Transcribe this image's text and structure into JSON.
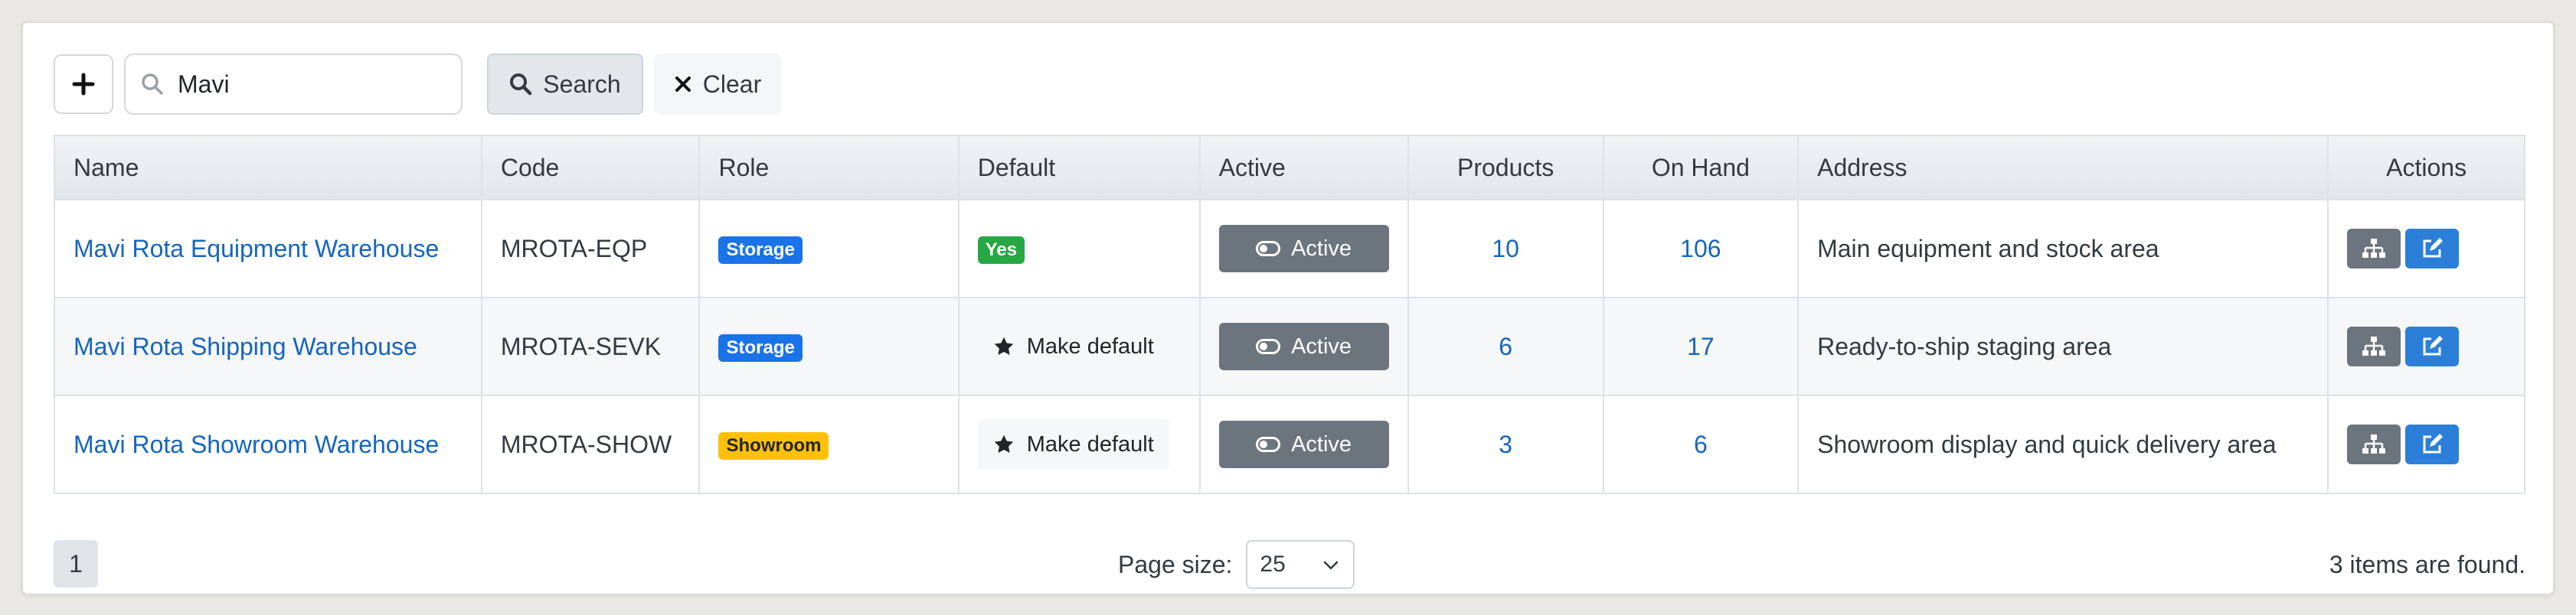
{
  "toolbar": {
    "add_label": "+",
    "search_value": "Mavi",
    "search_label": "Search",
    "clear_label": "Clear"
  },
  "table": {
    "columns": [
      "Name",
      "Code",
      "Role",
      "Default",
      "Active",
      "Products",
      "On Hand",
      "Address",
      "Actions"
    ],
    "rows": [
      {
        "name": "Mavi Rota Equipment Warehouse",
        "code": "MROTA-EQP",
        "role": "Storage",
        "default": "Yes",
        "default_is_set": true,
        "active": "Active",
        "products": "10",
        "on_hand": "106",
        "address": "Main equipment and stock area"
      },
      {
        "name": "Mavi Rota Shipping Warehouse",
        "code": "MROTA-SEVK",
        "role": "Storage",
        "default": "Make default",
        "default_is_set": false,
        "active": "Active",
        "products": "6",
        "on_hand": "17",
        "address": "Ready-to-ship staging area"
      },
      {
        "name": "Mavi Rota Showroom Warehouse",
        "code": "MROTA-SHOW",
        "role": "Showroom",
        "default": "Make default",
        "default_is_set": false,
        "active": "Active",
        "products": "3",
        "on_hand": "6",
        "address": "Showroom display and quick delivery area"
      }
    ]
  },
  "footer": {
    "current_page": "1",
    "page_size_label": "Page size:",
    "page_size_value": "25",
    "items_found": "3 items are found."
  },
  "colors": {
    "link": "#1565c0",
    "badge_storage": "#1a73e8",
    "badge_showroom": "#ffc107",
    "badge_yes": "#28a745",
    "active_button": "#6c757d",
    "edit_button": "#2b7fd8"
  },
  "icons": {
    "add": "plus-icon",
    "search": "magnifier-icon",
    "clear": "x-icon",
    "make_default": "star-icon",
    "active_toggle": "toggle-icon",
    "hierarchy": "sitemap-icon",
    "edit": "edit-icon",
    "page_size": "chevron-down-icon"
  }
}
